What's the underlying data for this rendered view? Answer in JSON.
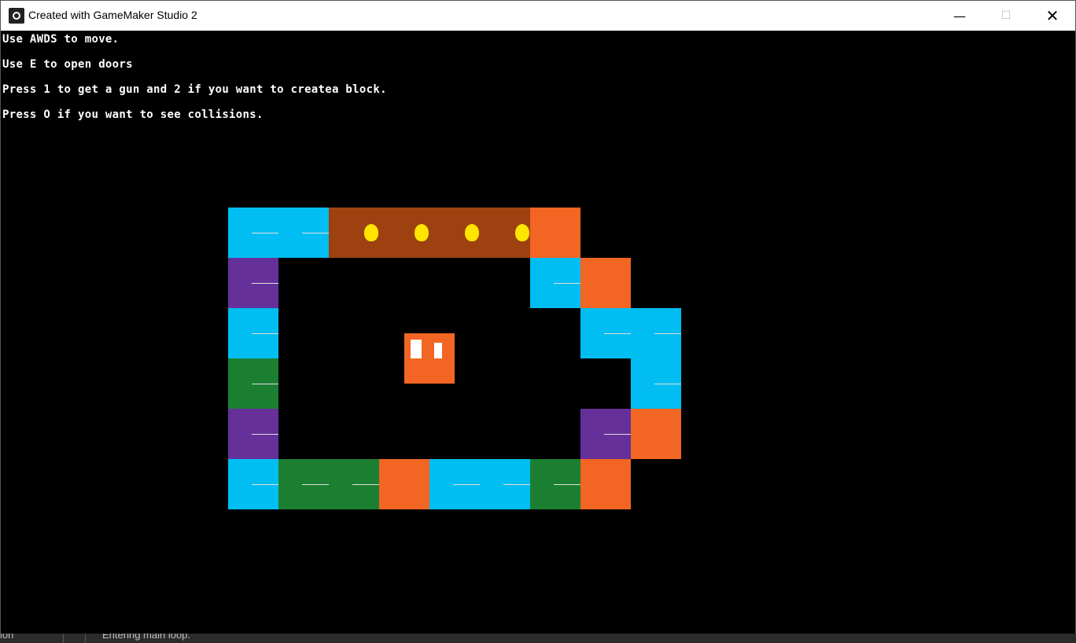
{
  "window": {
    "title": "Created with GameMaker Studio 2",
    "minimize_icon": "minimize-icon",
    "maximize_icon": "maximize-icon",
    "close_icon": "close-icon",
    "minimize_glyph": "—",
    "maximize_glyph": "☐",
    "close_glyph": "✕"
  },
  "instructions": [
    "Use AWDS to move.",
    "Use E to open doors",
    "Press 1 to get a gun and 2 if you want to createa block.",
    "Press O if you want to see collisions."
  ],
  "colors": {
    "cyan": "#00bef2",
    "purple": "#65309a",
    "green": "#1b7f32",
    "orange": "#f26522",
    "brown": "#9c410f",
    "lamp": "#ffe400",
    "player": "#f26522"
  },
  "statusbar": {
    "left_text": "ión",
    "log_text": "Entering main loop."
  }
}
